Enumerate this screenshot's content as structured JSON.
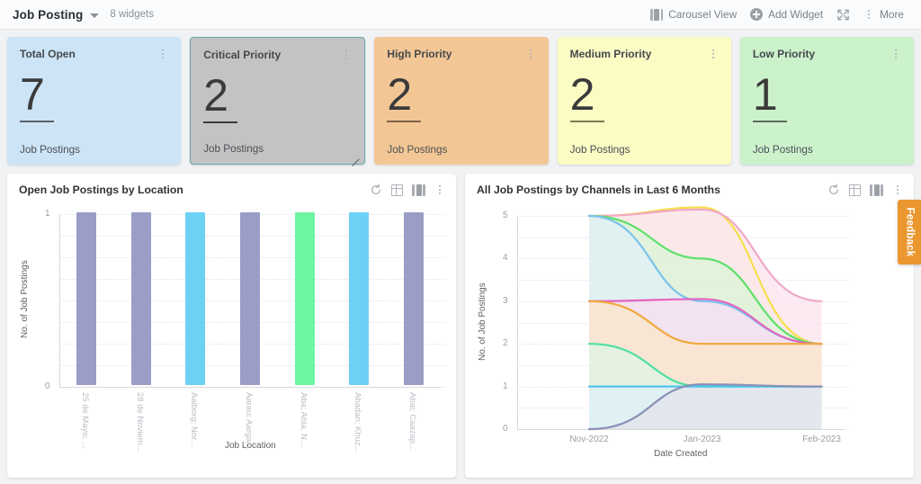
{
  "header": {
    "title": "Job Posting",
    "widget_count": "8 widgets",
    "actions": [
      {
        "icon": "carousel-view-icon",
        "label": "Carousel View"
      },
      {
        "icon": "add-widget-icon",
        "label": "Add Widget"
      },
      {
        "icon": "expand-icon",
        "label": ""
      },
      {
        "icon": "kebab-menu-icon",
        "label": "More"
      }
    ]
  },
  "kpi_cards": [
    {
      "title": "Total Open",
      "value": "7",
      "subtitle": "Job Postings",
      "bg": "#cce4f6",
      "underline": "#5a6169",
      "selected": false
    },
    {
      "title": "Critical Priority",
      "value": "2",
      "subtitle": "Job Postings",
      "bg": "#c3c3c3",
      "underline": "#3b3b3b",
      "selected": true
    },
    {
      "title": "High Priority",
      "value": "2",
      "subtitle": "Job Postings",
      "bg": "#f3c795",
      "underline": "#7d6245",
      "selected": false
    },
    {
      "title": "Medium Priority",
      "value": "2",
      "subtitle": "Job Postings",
      "bg": "#fbfbc4",
      "underline": "#7b7b52",
      "selected": false
    },
    {
      "title": "Low Priority",
      "value": "1",
      "subtitle": "Job Postings",
      "bg": "#ccf2cc",
      "underline": "#5e6b5e",
      "selected": false
    }
  ],
  "panels": [
    {
      "title": "Open Job Postings by Location",
      "tools": [
        "refresh-icon",
        "table-view-icon",
        "carousel-view-icon",
        "kebab-menu-icon"
      ]
    },
    {
      "title": "All Job Postings by Channels in Last 6 Months",
      "tools": [
        "refresh-icon",
        "table-view-icon",
        "carousel-view-icon",
        "kebab-menu-icon"
      ]
    }
  ],
  "feedback": {
    "label": "Feedback",
    "color": "#eb9730"
  },
  "chart_data": [
    {
      "type": "bar",
      "title": "Open Job Postings by Location",
      "xlabel": "Job Location",
      "ylabel": "No. of Job Postings",
      "ylim": [
        0,
        1
      ],
      "yticks": [
        "0",
        "1"
      ],
      "grid": true,
      "categories": [
        "25 de Mayo; ...",
        "28 de Noviem...",
        "Aalborg; Nor...",
        "Aarau; Aarga...",
        "Aba; Abia; N...",
        "Abadan; Khuz...",
        "Abai; Caazap..."
      ],
      "values": [
        1,
        1,
        1,
        1,
        1,
        1,
        1
      ],
      "colors": [
        "#9a9dc6",
        "#9a9dc6",
        "#6dd1f5",
        "#9a9dc6",
        "#6ef5a2",
        "#6dd1f5",
        "#9a9dc6"
      ]
    },
    {
      "type": "area",
      "title": "All Job Postings by Channels in Last 6 Months",
      "xlabel": "Date Created",
      "ylabel": "No. of Job Postings",
      "ylim": [
        0,
        5
      ],
      "yticks": [
        "0",
        "1",
        "2",
        "3",
        "4",
        "5"
      ],
      "x": [
        "Nov-2022",
        "Jan-2023",
        "Feb-2023"
      ],
      "grid": true,
      "series": [
        {
          "name": "series-yellow",
          "values": [
            5,
            5.2,
            2
          ],
          "color": "#f5e04d",
          "fill": "#fbf6cf"
        },
        {
          "name": "series-pink",
          "values": [
            5,
            5.15,
            3
          ],
          "color": "#f1a8c8",
          "fill": "#fbe2ee"
        },
        {
          "name": "series-green",
          "values": [
            5,
            4.0,
            2
          ],
          "color": "#5ee06b",
          "fill": "#d8f5d5"
        },
        {
          "name": "series-blue",
          "values": [
            5,
            3.0,
            2
          ],
          "color": "#79c3ec",
          "fill": "#e0effa"
        },
        {
          "name": "series-magenta",
          "values": [
            3,
            3.05,
            2
          ],
          "color": "#e364c0",
          "fill": "#f9dcf0"
        },
        {
          "name": "series-orange",
          "values": [
            3,
            2.0,
            2
          ],
          "color": "#f0a93c",
          "fill": "#fbe6c9"
        },
        {
          "name": "series-mint",
          "values": [
            2,
            1.0,
            1
          ],
          "color": "#4fe0a0",
          "fill": "#ddf6e8"
        },
        {
          "name": "series-cyan",
          "values": [
            1,
            1.0,
            1
          ],
          "color": "#4ec8f0",
          "fill": "#dcf0fa"
        },
        {
          "name": "series-slate",
          "values": [
            0,
            1.05,
            1
          ],
          "color": "#8a8fb5",
          "fill": "#e2e3ea"
        }
      ]
    }
  ]
}
